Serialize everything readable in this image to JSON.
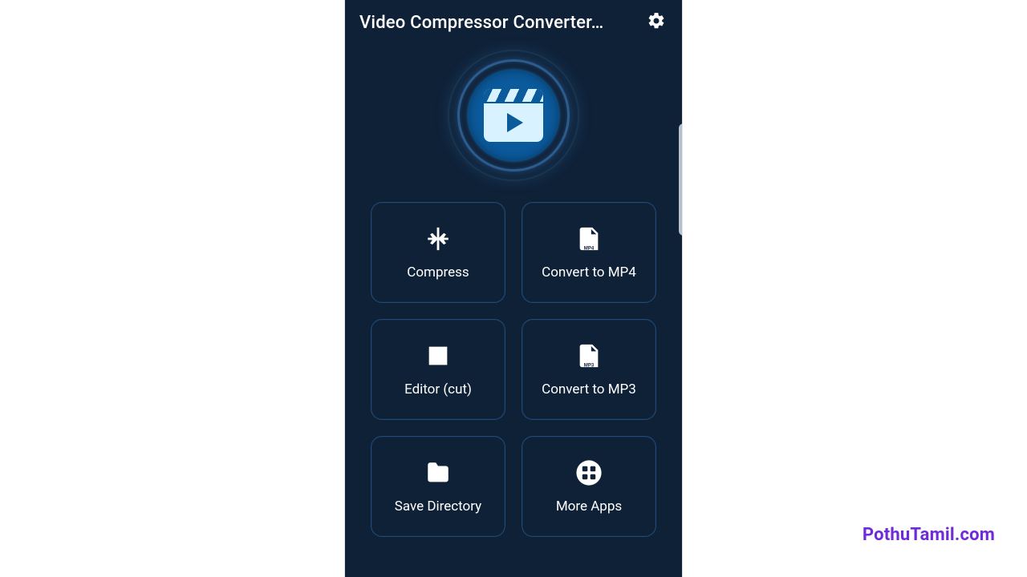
{
  "header": {
    "title": "Video Compressor Converter…"
  },
  "tiles": [
    {
      "icon": "compress-icon",
      "label": "Compress"
    },
    {
      "icon": "mp4-icon",
      "label": "Convert to MP4"
    },
    {
      "icon": "editor-cut-icon",
      "label": "Editor (cut)"
    },
    {
      "icon": "mp3-icon",
      "label": "Convert to MP3"
    },
    {
      "icon": "folder-icon",
      "label": "Save Directory"
    },
    {
      "icon": "more-apps-icon",
      "label": "More Apps"
    }
  ],
  "watermark": "PothuTamil.com",
  "colors": {
    "phone_bg": "#0f2137",
    "tile_border": "#1f4a78",
    "accent": "#0b5a9c",
    "watermark": "#6f2bd9"
  }
}
